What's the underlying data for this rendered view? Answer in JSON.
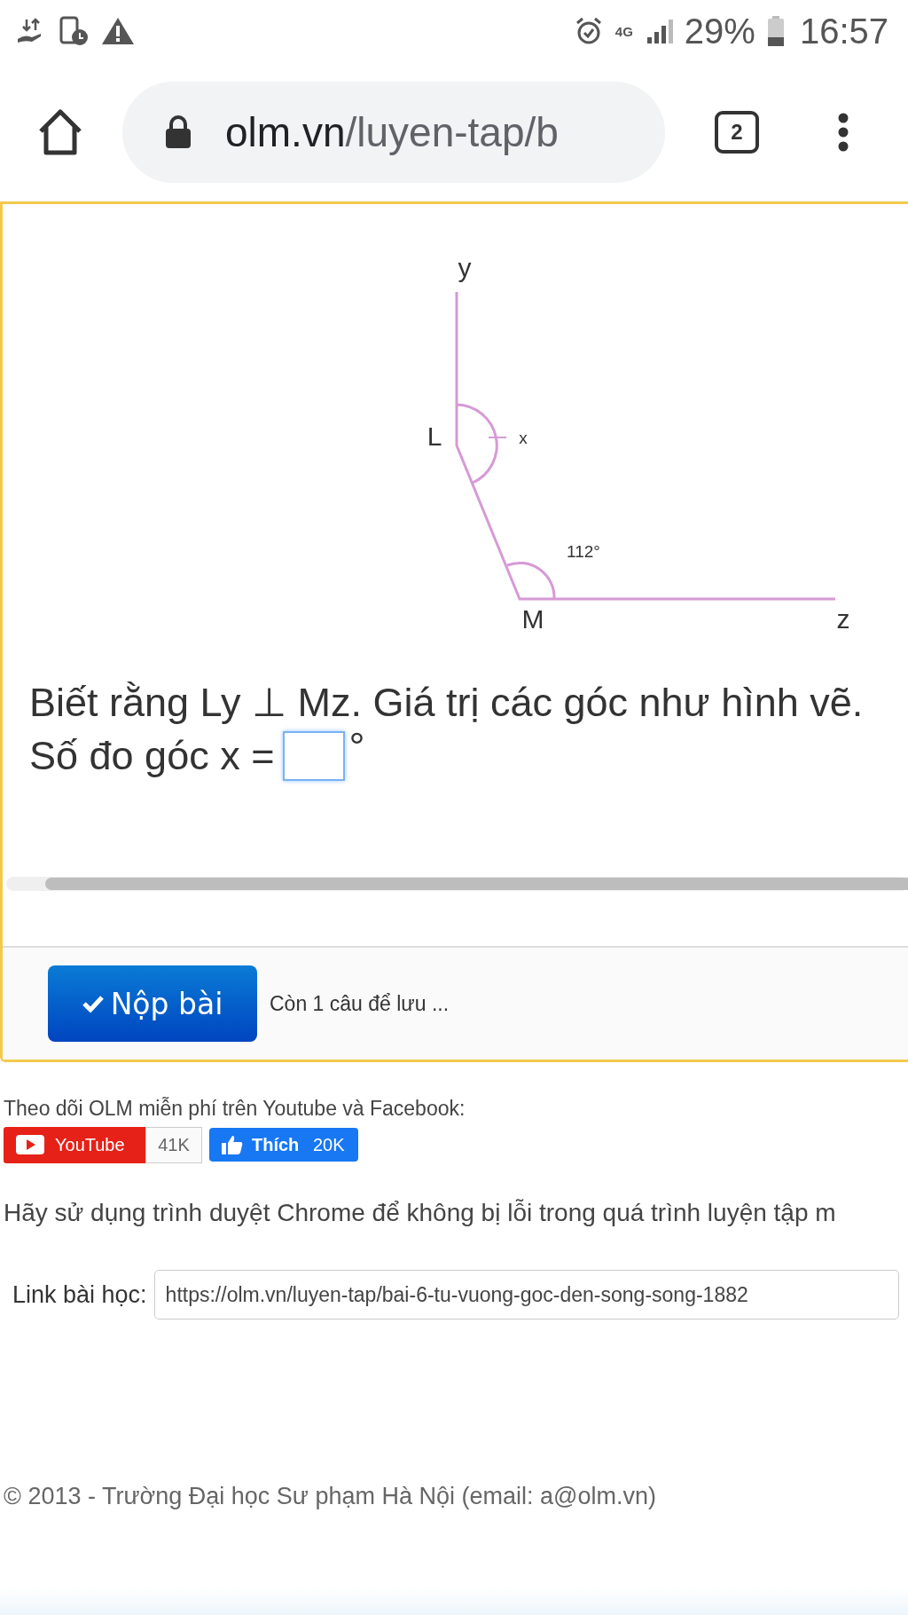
{
  "status_bar": {
    "network": "4G",
    "battery": "29%",
    "time": "16:57"
  },
  "browser": {
    "url_host": "olm.vn",
    "url_path": "/luyen-tap/b",
    "tab_count": "2"
  },
  "exercise": {
    "figure": {
      "ray_top": "y",
      "vertex_upper": "L",
      "angle_upper": "x",
      "angle_lower": "112°",
      "vertex_lower": "M",
      "ray_right": "z"
    },
    "statement": "Biết rằng Ly ⊥ Mz. Giá trị các góc như hình vẽ.",
    "prompt": "Số đo góc x =",
    "unit": "°",
    "submit": "Nộp bài",
    "remaining": "Còn 1 câu để lưu ..."
  },
  "follow": {
    "text": "Theo dõi OLM miễn phí trên Youtube và Facebook:",
    "youtube": {
      "label": "YouTube",
      "count": "41K"
    },
    "facebook": {
      "label": "Thích",
      "count": "20K"
    }
  },
  "browser_tip": "Hãy sử dụng trình duyệt Chrome để không bị lỗi trong quá trình luyện tập m",
  "lesson_link": {
    "label": "Link bài học:",
    "value": "https://olm.vn/luyen-tap/bai-6-tu-vuong-goc-den-song-song-1882"
  },
  "footer": "© 2013 - Trường Đại học Sư phạm Hà Nội (email: a@olm.vn)"
}
